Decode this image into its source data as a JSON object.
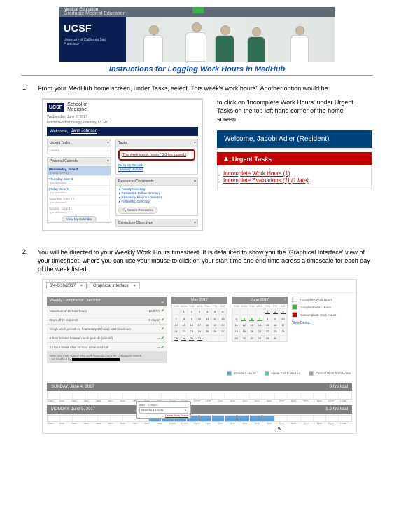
{
  "banner": {
    "dept": "Medical Education",
    "gme": "Graduate Medical Education",
    "ucsf": "UCSF",
    "org": "University of California San Francisco"
  },
  "title": "Instructions for Logging Work Hours in MedHub",
  "steps": {
    "s1": "From your MedHub home screen, under Tasks, select 'This week's work hours'.  Another option would be",
    "s1b": "to click on 'Incomplete Work Hours' under Urgent Tasks on the top left hand corner of the home screen.",
    "s2": "You will be directed to your Weekly Work Hours timesheet.  It is defaulted to show you the 'Graphical Interface' view of your timesheet, where you can use your mouse to click on your start time and end time across a timescale for each day of the week listed."
  },
  "shot1": {
    "ucsf": "UCSF",
    "som1": "School of",
    "som2": "Medicine",
    "date": "Wednesday, June 7, 2017",
    "subhead": "Internal Endocrinology, Infertility, UCMC",
    "welcome": "Welcome,",
    "name": "Jann Johnson",
    "urgent_h": "Urgent Tasks",
    "none": "(none)",
    "pcal_h": "Personal Calendar",
    "cal": [
      {
        "d": "Wednesday, June 7",
        "s": "(no activities)"
      },
      {
        "d": "Thursday, June 8",
        "s": "(no activities)"
      },
      {
        "d": "Friday, June 9",
        "s": "(no activities)"
      },
      {
        "d": "Saturday, June 10",
        "s": "(no activities)"
      },
      {
        "d": "Sunday, June 11",
        "s": "(no activities)"
      }
    ],
    "view_cal": "View My Calendar",
    "tasks_h": "Tasks",
    "task_link1": "This week's work hours  ( 0.0 hrs logged )",
    "link_records": "Go to My Records",
    "link_learning": "Learning Modules",
    "res_h": "Resources/Documents",
    "res": [
      "Faculty Directory",
      "Resident & Fellow Directory",
      "Residency Program Directory",
      "Fellowship Directory"
    ],
    "search": "Search Resources",
    "obj_h": "Curriculum Objectives"
  },
  "welcome_lg": "Welcome, Jacobi Adler (Resident)",
  "urgent": {
    "title": "Urgent Tasks",
    "l1": "Incomplete Work Hours (1)",
    "l2a": "Incomplete Evaluations ",
    "l2b": "(1) (1 late)"
  },
  "shot2": {
    "week": "6/4-6/10/2017",
    "iface": "Graphical Interface",
    "wc_h": "Weekly Compliance Checklist",
    "wc": [
      {
        "t": "Maximum of 80 total hours",
        "v": "10.0 hrs"
      },
      {
        "t": "Days off (1 required)",
        "v": "5 day(s)"
      },
      {
        "t": "Single work period: 24 hours duty/28 hours total maximum",
        "v": "—"
      },
      {
        "t": "8 hour breaks between work periods (should)",
        "v": "—"
      },
      {
        "t": "14 hour break after 24 hour scheduled call",
        "v": "—"
      }
    ],
    "wc_note": "Note: you must submit your work hours to check for compliance issues.",
    "wc_last": "Last Modified by",
    "cal1_h": "May 2017",
    "cal2_h": "June 2017",
    "dow": [
      "SUN",
      "MON",
      "TUE",
      "WED",
      "THU",
      "FRI",
      "SAT"
    ],
    "leg": [
      "Incomplete Work Hours",
      "Compliant Work Hours",
      "Noncompliant Work Hours"
    ],
    "leg_colors": [
      "#ffffff",
      "#3fae4e",
      "#c20000"
    ],
    "view_demo": "View Demo",
    "legend_row": [
      {
        "c": "#5a9fd4",
        "t": "Standard Hours"
      },
      {
        "c": "#66c28f",
        "t": "Home Call (called in)"
      },
      {
        "c": "#9e9e9c",
        "t": "Clinical Work from Home"
      }
    ],
    "day1": {
      "label": "SUNDAY, June 4, 2017",
      "total": "0 hrs total"
    },
    "day2": {
      "label": "MONDAY, June 5, 2017",
      "total": "9.5 hrs total"
    },
    "hours": [
      "12am",
      "1am",
      "2am",
      "3am",
      "4am",
      "5am",
      "6am",
      "7am",
      "8am",
      "9am",
      "10am",
      "11am",
      "12pm",
      "1pm",
      "2pm",
      "3pm",
      "4pm",
      "5pm",
      "6pm",
      "7pm",
      "8pm",
      "9pm",
      "10pm",
      "11pm",
      "12am"
    ],
    "popup": {
      "time": "8am – 5:30pm",
      "dd": "Standard Hours",
      "cancel": "Delete Work Period"
    }
  }
}
